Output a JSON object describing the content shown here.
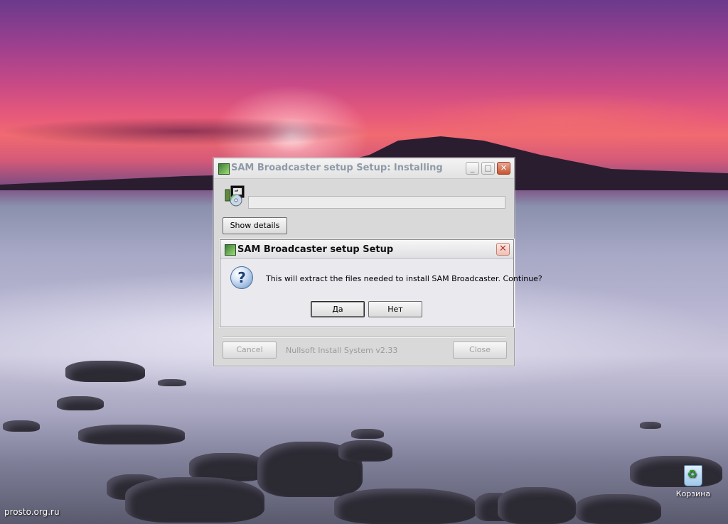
{
  "desktop": {
    "watermark": "prosto.org.ru",
    "recycle_bin_label": "Корзина"
  },
  "installer": {
    "title": "SAM Broadcaster setup Setup: Installing",
    "progress_value": 0,
    "show_details_label": "Show details",
    "cancel_label": "Cancel",
    "close_label": "Close",
    "branding": "Nullsoft Install System v2.33",
    "caption_buttons": {
      "minimize": "_",
      "maximize": "□",
      "close": "✕"
    }
  },
  "dialog": {
    "title": "SAM Broadcaster setup Setup",
    "message": "This will extract the files needed to install SAM Broadcaster. Continue?",
    "icon_glyph": "?",
    "yes_label": "Да",
    "no_label": "Нет",
    "close_glyph": "✕"
  },
  "icons": {
    "installer_icon": "installer-disk-icon",
    "dialog_icon": "question-icon",
    "recycle_bin": "recycle-bin-icon"
  }
}
